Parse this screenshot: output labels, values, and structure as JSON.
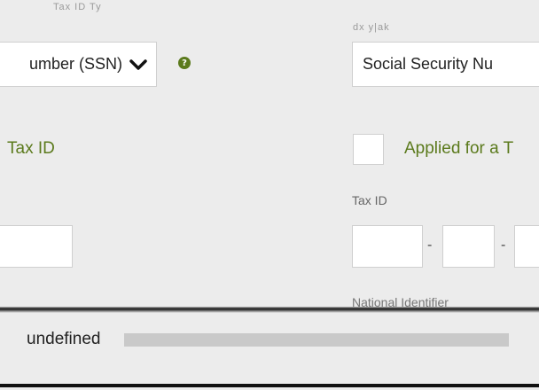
{
  "header": {
    "left_clip": "Tax ID Ty",
    "right_clip": "dx  y|ak"
  },
  "tax_id_type": {
    "selected_label": "umber (SSN)",
    "right_value": "Social Security Nu"
  },
  "labels": {
    "tax_id_left": "Tax ID",
    "applied_for": "Applied for a T",
    "tax_id_right": "Tax ID",
    "national_identifier": "National Identifier"
  },
  "tax_id_inputs": {
    "separator": "-",
    "values": [
      "",
      "",
      ""
    ]
  },
  "national_identifier": {
    "value": "undefined"
  },
  "icons": {
    "help": "question-circle-icon",
    "dropdown": "chevron-down-icon"
  },
  "colors": {
    "accent_green": "#5b7a1c",
    "background": "#ececec"
  }
}
